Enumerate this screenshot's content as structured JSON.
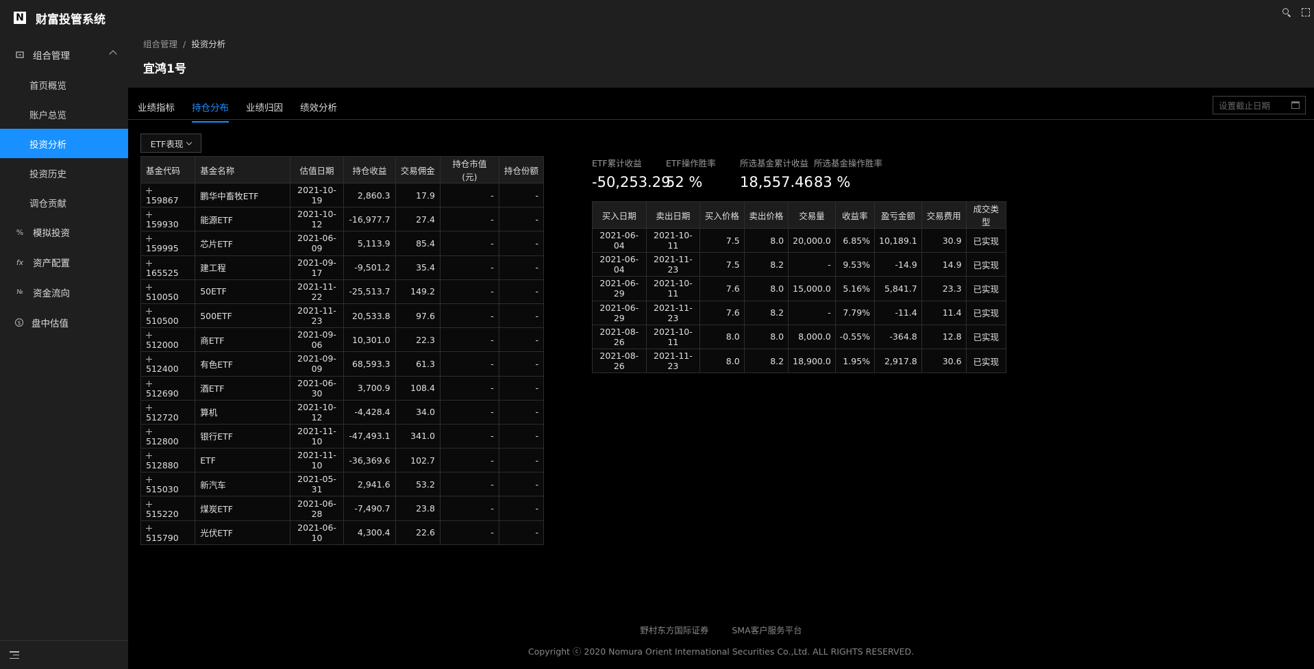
{
  "app": {
    "logo_mark": "N",
    "title": "财富投管系统"
  },
  "sidebar": {
    "group1": {
      "label": "组合管理",
      "icon": "portfolio-icon"
    },
    "sub_items": [
      {
        "label": "首页概览",
        "active": false
      },
      {
        "label": "账户总览",
        "active": false
      },
      {
        "label": "投资分析",
        "active": true
      },
      {
        "label": "投资历史",
        "active": false
      },
      {
        "label": "调仓贡献",
        "active": false
      }
    ],
    "groups": [
      {
        "label": "模拟投资",
        "icon_glyph": "%"
      },
      {
        "label": "资产配置",
        "icon_glyph": "fx"
      },
      {
        "label": "资金流向",
        "icon_glyph": "№"
      },
      {
        "label": "盘中估值",
        "icon_glyph": "$"
      }
    ]
  },
  "header": {
    "breadcrumb": [
      "组合管理",
      "投资分析"
    ],
    "separator": "/",
    "title": "宜鸿1号"
  },
  "tabs": [
    "业绩指标",
    "持仓分布",
    "业绩归因",
    "绩效分析"
  ],
  "active_tab": 1,
  "date_picker": {
    "placeholder": "设置截止日期"
  },
  "etf_select": {
    "value": "ETF表现"
  },
  "etf_table": {
    "headers": [
      "基金代码",
      "基金名称",
      "估值日期",
      "持仓收益",
      "交易佣金",
      "持仓市值(元)",
      "持仓份额"
    ],
    "rows": [
      [
        "159867",
        "鹏华中畜牧ETF",
        "2021-10-19",
        "2,860.3",
        "17.9",
        "-",
        "-"
      ],
      [
        "159930",
        "能源ETF",
        "2021-10-12",
        "-16,977.7",
        "27.4",
        "-",
        "-"
      ],
      [
        "159995",
        "芯片ETF",
        "2021-06-09",
        "5,113.9",
        "85.4",
        "-",
        "-"
      ],
      [
        "165525",
        "建工程",
        "2021-09-17",
        "-9,501.2",
        "35.4",
        "-",
        "-"
      ],
      [
        "510050",
        "50ETF",
        "2021-11-22",
        "-25,513.7",
        "149.2",
        "-",
        "-"
      ],
      [
        "510500",
        "500ETF",
        "2021-11-23",
        "20,533.8",
        "97.6",
        "-",
        "-"
      ],
      [
        "512000",
        "商ETF",
        "2021-09-06",
        "10,301.0",
        "22.3",
        "-",
        "-"
      ],
      [
        "512400",
        "有色ETF",
        "2021-09-09",
        "68,593.3",
        "61.3",
        "-",
        "-"
      ],
      [
        "512690",
        "酒ETF",
        "2021-06-30",
        "3,700.9",
        "108.4",
        "-",
        "-"
      ],
      [
        "512720",
        "算机",
        "2021-10-12",
        "-4,428.4",
        "34.0",
        "-",
        "-"
      ],
      [
        "512800",
        "银行ETF",
        "2021-11-10",
        "-47,493.1",
        "341.0",
        "-",
        "-"
      ],
      [
        "512880",
        "ETF",
        "2021-11-10",
        "-36,369.6",
        "102.7",
        "-",
        "-"
      ],
      [
        "515030",
        "新汽车",
        "2021-05-31",
        "2,941.6",
        "53.2",
        "-",
        "-"
      ],
      [
        "515220",
        "煤炭ETF",
        "2021-06-28",
        "-7,490.7",
        "23.8",
        "-",
        "-"
      ],
      [
        "515790",
        "光伏ETF",
        "2021-06-10",
        "4,300.4",
        "22.6",
        "-",
        "-"
      ]
    ]
  },
  "stats": [
    {
      "label": "ETF累计收益",
      "value": "-50,253.29"
    },
    {
      "label": "ETF操作胜率",
      "value": "52 %"
    },
    {
      "label": "所选基金累计收益",
      "value": "18,557.46"
    },
    {
      "label": "所选基金操作胜率",
      "value": "83 %"
    }
  ],
  "trade_table": {
    "headers": [
      "买入日期",
      "卖出日期",
      "买入价格",
      "卖出价格",
      "交易量",
      "收益率",
      "盈亏金额",
      "交易费用",
      "成交类型"
    ],
    "rows": [
      [
        "2021-06-04",
        "2021-10-11",
        "7.5",
        "8.0",
        "20,000.0",
        "6.85%",
        "10,189.1",
        "30.9",
        "已实现"
      ],
      [
        "2021-06-04",
        "2021-11-23",
        "7.5",
        "8.2",
        "-",
        "9.53%",
        "-14.9",
        "14.9",
        "已实现"
      ],
      [
        "2021-06-29",
        "2021-10-11",
        "7.6",
        "8.0",
        "15,000.0",
        "5.16%",
        "5,841.7",
        "23.3",
        "已实现"
      ],
      [
        "2021-06-29",
        "2021-11-23",
        "7.6",
        "8.2",
        "-",
        "7.79%",
        "-11.4",
        "11.4",
        "已实现"
      ],
      [
        "2021-08-26",
        "2021-10-11",
        "8.0",
        "8.0",
        "8,000.0",
        "-0.55%",
        "-364.8",
        "12.8",
        "已实现"
      ],
      [
        "2021-08-26",
        "2021-11-23",
        "8.0",
        "8.2",
        "18,900.0",
        "1.95%",
        "2,917.8",
        "30.6",
        "已实现"
      ]
    ]
  },
  "footer": {
    "links": [
      "野村东方国际证券",
      "SMA客户服务平台"
    ],
    "copyright": "Copyright ⓒ 2020 Nomura Orient International Securities Co.,Ltd. ALL RIGHTS RESERVED."
  },
  "colors": {
    "accent": "#1890ff",
    "sidebar_bg": "#1f1f1f",
    "page_bg": "#000000"
  }
}
